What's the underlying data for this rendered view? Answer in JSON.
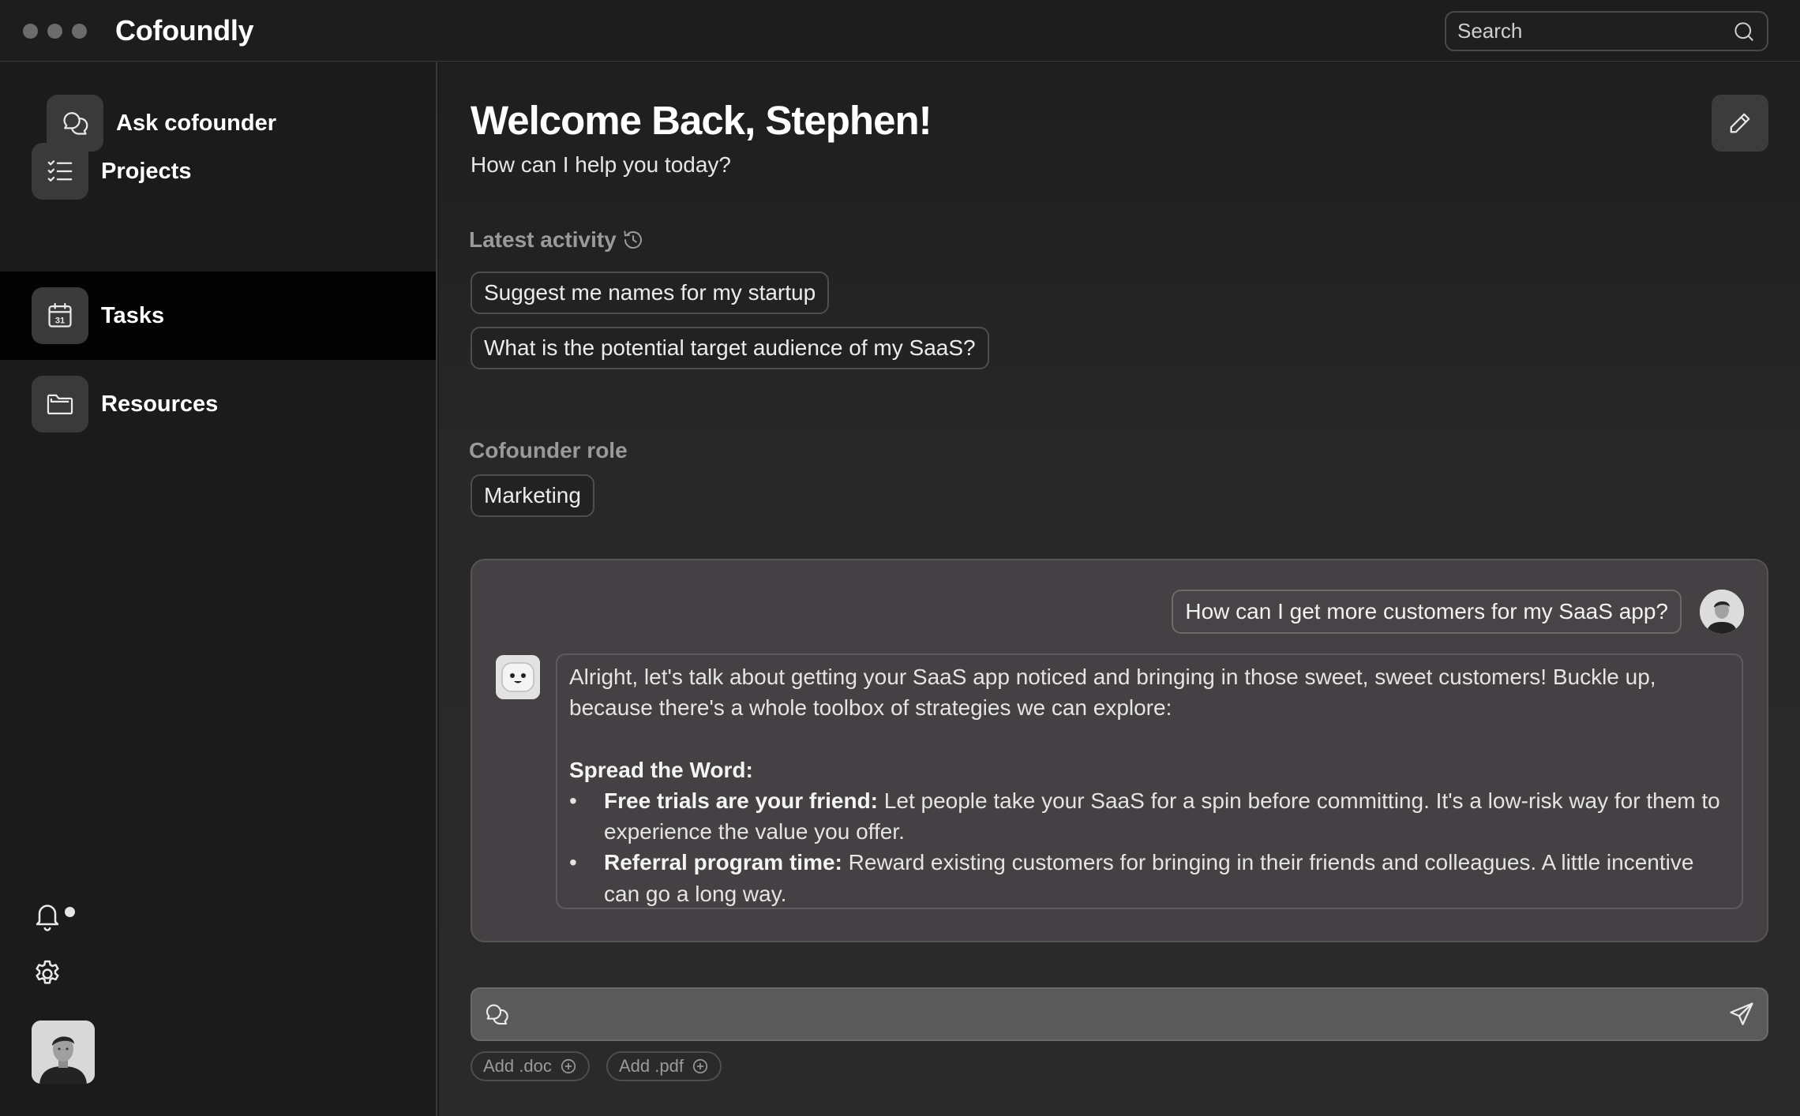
{
  "window": {
    "app_title": "Cofoundly",
    "search_placeholder": "Search"
  },
  "sidebar": {
    "ask_label": "Ask cofounder",
    "items": [
      {
        "label": "Projects",
        "icon": "checklist-icon",
        "active": false
      },
      {
        "label": "Tasks",
        "icon": "calendar-icon",
        "active": true
      },
      {
        "label": "Resources",
        "icon": "folder-icon",
        "active": false
      }
    ],
    "calendar_day": "31"
  },
  "main": {
    "welcome": "Welcome Back, Stephen!",
    "subtitle": "How can I help you today?",
    "latest_activity_label": "Latest activity",
    "activity_items": [
      "Suggest me names for my startup",
      "What is the potential target audience of my SaaS?"
    ],
    "role_label": "Cofounder role",
    "role_value": "Marketing"
  },
  "chat": {
    "user_message": "How can I get more customers for my SaaS app?",
    "bot_intro": "Alright, let's talk about getting your SaaS app noticed and bringing in those sweet, sweet customers! Buckle up, because there's a whole toolbox of strategies we can explore:",
    "section_title": "Spread the Word:",
    "bullets": [
      {
        "title": "Free trials are your friend:",
        "text": " Let people take your SaaS for a spin before committing. It's a low-risk way for them to experience the value you offer."
      },
      {
        "title": "Referral program time:",
        "text": " Reward existing customers for bringing in their friends and colleagues. A little incentive can go a long way."
      }
    ]
  },
  "composer": {
    "placeholder": "",
    "add_doc": "Add .doc",
    "add_pdf": "Add .pdf"
  },
  "colors": {
    "background": "#1c1c1c",
    "sidebar_active": "#030303",
    "chat_panel": "#444044",
    "composer": "#5a5a5a"
  }
}
